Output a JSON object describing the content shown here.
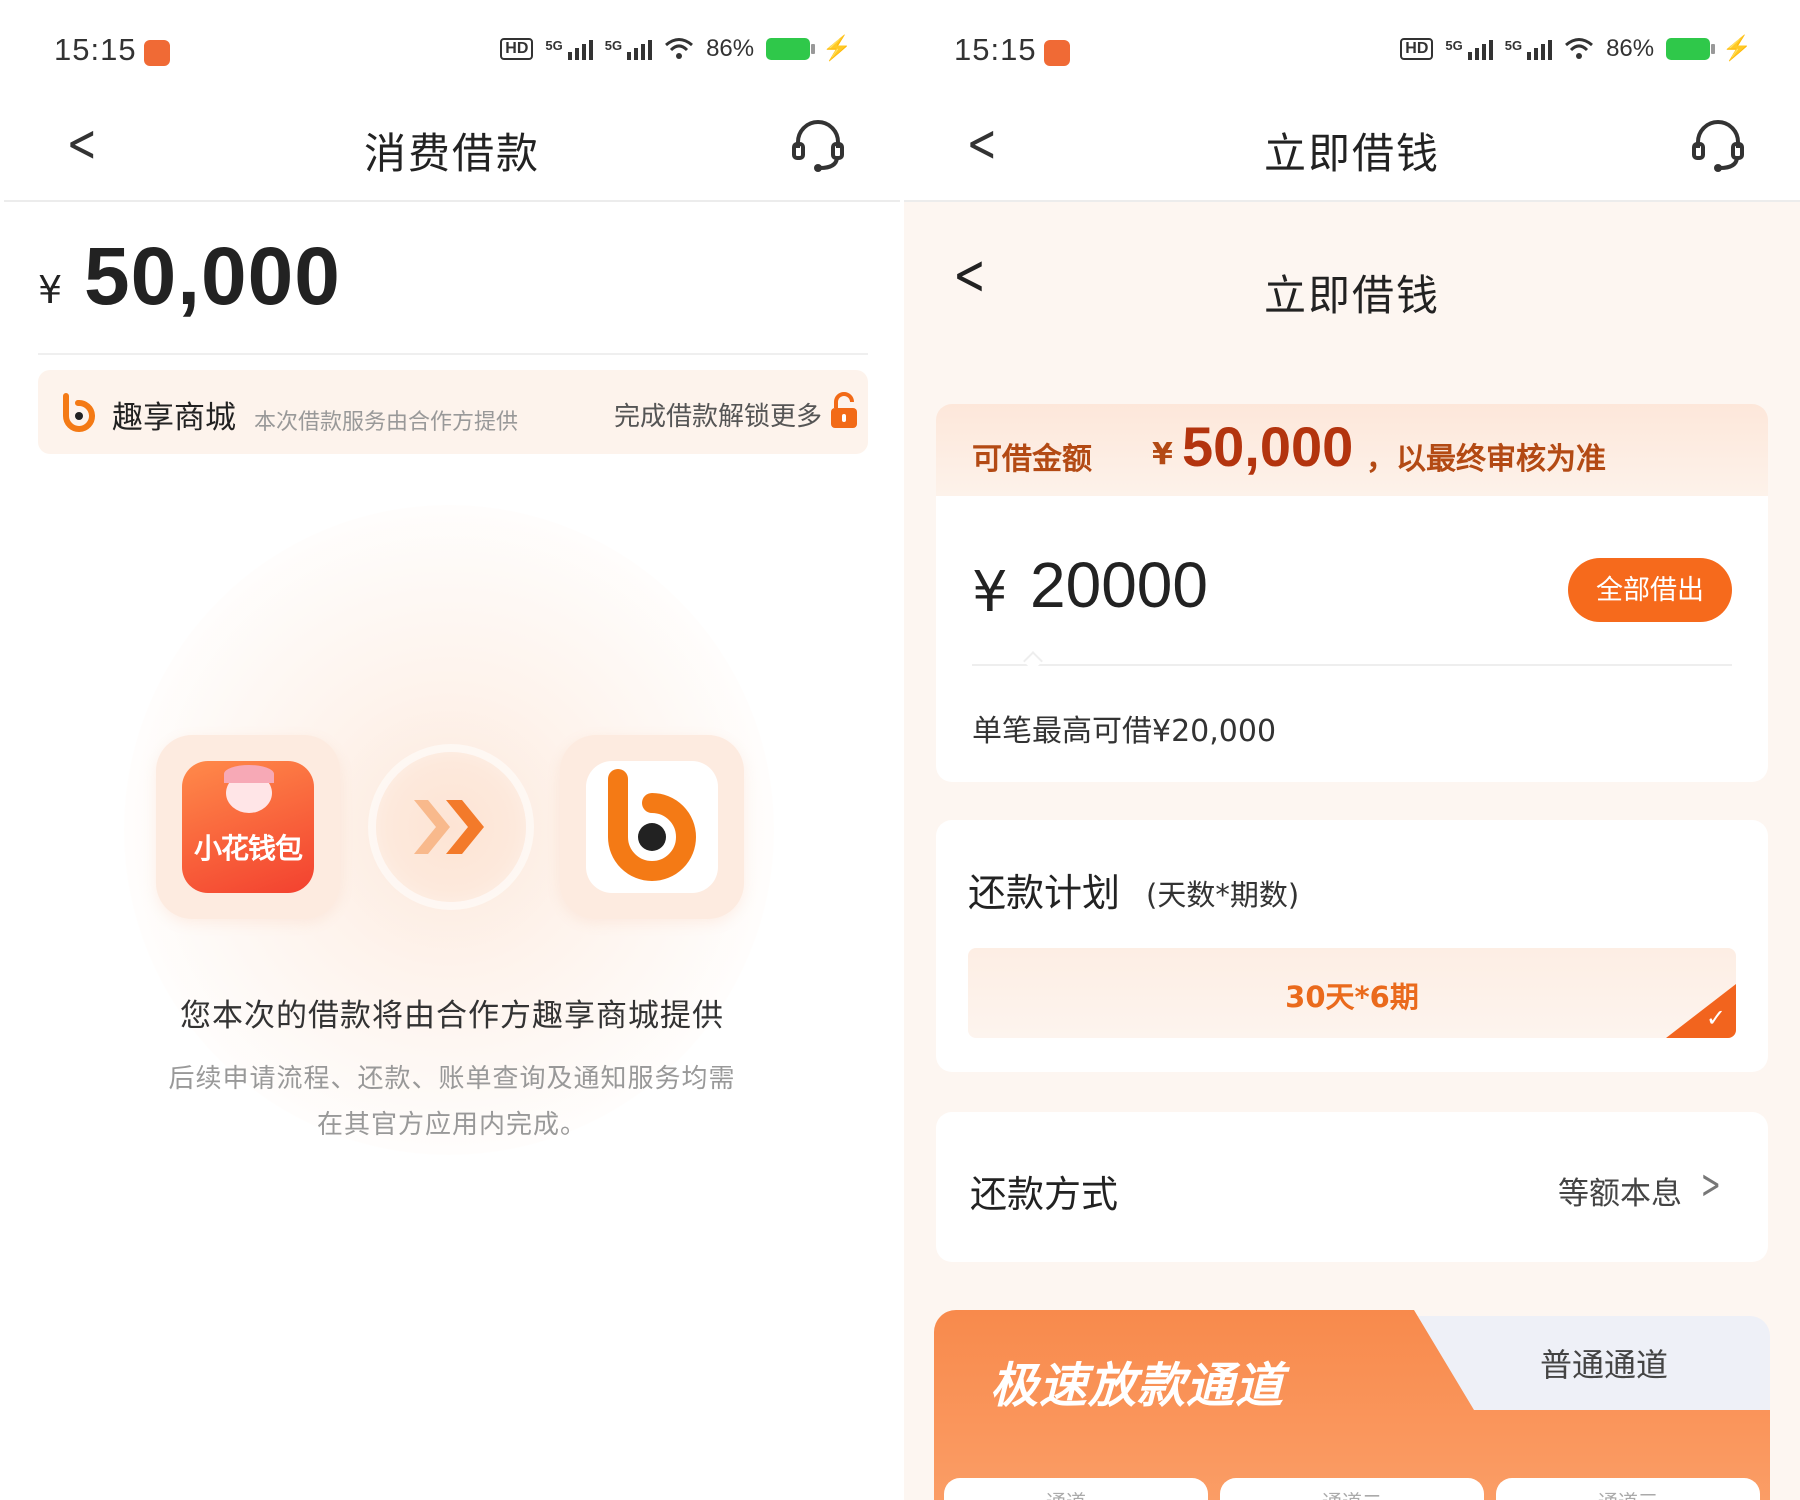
{
  "status_bar": {
    "time": "15:15",
    "network": "5G",
    "battery": "86%"
  },
  "left": {
    "nav": {
      "title": "消费借款"
    },
    "amount": {
      "currency": "¥",
      "value": "50,000"
    },
    "partner": {
      "name": "趣享商城",
      "note": "本次借款服务由合作方提供",
      "unlock": "完成借款解锁更多"
    },
    "app_a_label": "小花钱包",
    "message": "您本次的借款将由合作方趣享商城提供",
    "sub_line1": "后续申请流程、还款、账单查询及通知服务均需",
    "sub_line2": "在其官方应用内完成。"
  },
  "right": {
    "nav": {
      "title": "立即借钱"
    },
    "subnav": {
      "title": "立即借钱"
    },
    "limit": {
      "label": "可借金额",
      "currency": "¥",
      "amount": "50,000",
      "suffix": "，以最终审核为准"
    },
    "input": {
      "currency": "¥",
      "value": "20000",
      "all_button": "全部借出",
      "max_note": "单笔最高可借¥20,000"
    },
    "plan": {
      "title": "还款计划",
      "subtitle": "(天数*期数)",
      "option": "30天*6期"
    },
    "repay": {
      "label": "还款方式",
      "value": "等额本息"
    },
    "channels": {
      "fast": "极速放款通道",
      "normal": "普通通道",
      "tabs": [
        "通道一",
        "通道二",
        "通道三"
      ]
    }
  }
}
